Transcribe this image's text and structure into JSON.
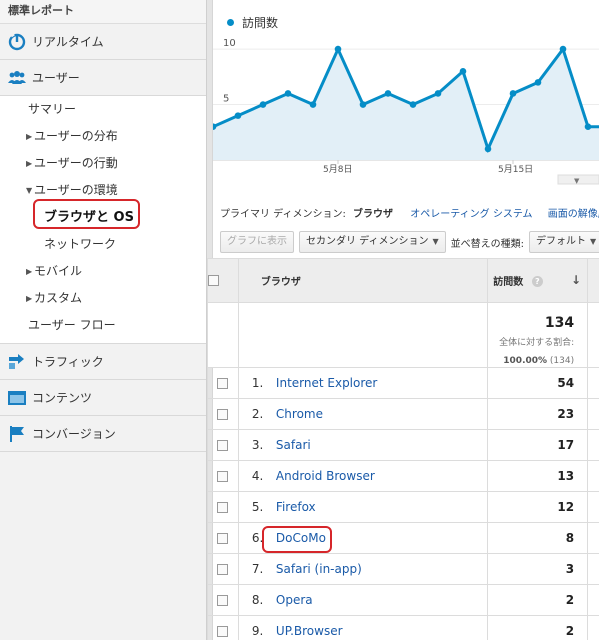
{
  "sidebar": {
    "header": "標準レポート",
    "realtime": "リアルタイム",
    "users": "ユーザー",
    "users_items": {
      "summary": "サマリー",
      "distribution": "ユーザーの分布",
      "behavior": "ユーザーの行動",
      "environment": "ユーザーの環境",
      "browser_os": "ブラウザと OS",
      "network": "ネットワーク",
      "mobile": "モバイル",
      "custom": "カスタム",
      "flow": "ユーザー フロー"
    },
    "traffic": "トラフィック",
    "content": "コンテンツ",
    "conversion": "コンバージョン"
  },
  "chart_data": {
    "type": "area",
    "series": [
      {
        "name": "訪問数",
        "color": "#058dc7",
        "values": [
          3,
          4,
          5,
          6,
          5,
          10,
          5,
          6,
          5,
          6,
          8,
          1,
          6,
          7,
          10,
          3,
          3
        ]
      }
    ],
    "x_tick_labels": [
      "5月8日",
      "5月15日"
    ],
    "y_tick_labels": [
      "10",
      "5"
    ],
    "ylim": [
      0,
      11
    ]
  },
  "dimensions": {
    "label": "プライマリ ディメンション:",
    "current": "ブラウザ",
    "links": [
      "オペレーティング システム",
      "画面の解像度",
      "画面"
    ]
  },
  "toolbar": {
    "graph_btn": "グラフに表示",
    "secondary_dim": "セカンダリ ディメンション",
    "sort_label": "並べ替えの種類:",
    "sort_value": "デフォルト"
  },
  "table": {
    "col_browser": "ブラウザ",
    "col_visits": "訪問数",
    "help_icon": "?",
    "total": "134",
    "total_label": "全体に対する割合:",
    "total_pct": "100.00%",
    "total_of": "(134)",
    "rows": [
      {
        "idx": "1.",
        "name": "Internet Explorer",
        "value": "54"
      },
      {
        "idx": "2.",
        "name": "Chrome",
        "value": "23"
      },
      {
        "idx": "3.",
        "name": "Safari",
        "value": "17"
      },
      {
        "idx": "4.",
        "name": "Android Browser",
        "value": "13"
      },
      {
        "idx": "5.",
        "name": "Firefox",
        "value": "12"
      },
      {
        "idx": "6.",
        "name": "DoCoMo",
        "value": "8"
      },
      {
        "idx": "7.",
        "name": "Safari (in-app)",
        "value": "3"
      },
      {
        "idx": "8.",
        "name": "Opera",
        "value": "2"
      },
      {
        "idx": "9.",
        "name": "UP.Browser",
        "value": "2"
      }
    ]
  }
}
